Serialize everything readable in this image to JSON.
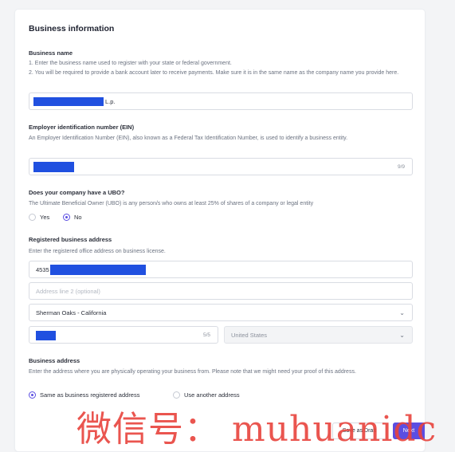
{
  "section_title": "Business information",
  "business_name": {
    "label": "Business name",
    "line1": "1. Enter the business name used to register with your state or federal government.",
    "line2": "2. You will be required to provide a bank account later to receive payments. Make sure it is in the same name as the company name you provide here.",
    "value_suffix": "L.p."
  },
  "ein": {
    "label": "Employer identification number (EIN)",
    "description": "An Employer Identification Number (EIN), also known as a Federal Tax Identification Number, is used to identify a business entity.",
    "counter": "9/9"
  },
  "ubo": {
    "label": "Does your company have a UBO?",
    "description": "The Ultimate Beneficial Owner (UBO) is any person/s who owns at least 25% of shares of a company or legal entity",
    "options": [
      "Yes",
      "No"
    ],
    "selected": "No"
  },
  "registered_address": {
    "label": "Registered business address",
    "description": "Enter the registered office address on business license.",
    "line1_prefix": "4535",
    "line2_placeholder": "Address line 2 (optional)",
    "city_state": "Sherman Oaks - California",
    "zip_counter": "5/5",
    "country": "United States"
  },
  "business_address": {
    "label": "Business address",
    "description": "Enter the address where you are physically operating your business from. Please note that we might need your proof of this address.",
    "options": [
      "Same as business registered address",
      "Use another address"
    ],
    "selected": "Same as business registered address"
  },
  "footer": {
    "save_draft": "Save as Draft",
    "next": "Next"
  },
  "colors": {
    "accent": "#5b4ee2",
    "redaction": "#2050e0"
  },
  "watermark": "微信号： muhuanidc"
}
